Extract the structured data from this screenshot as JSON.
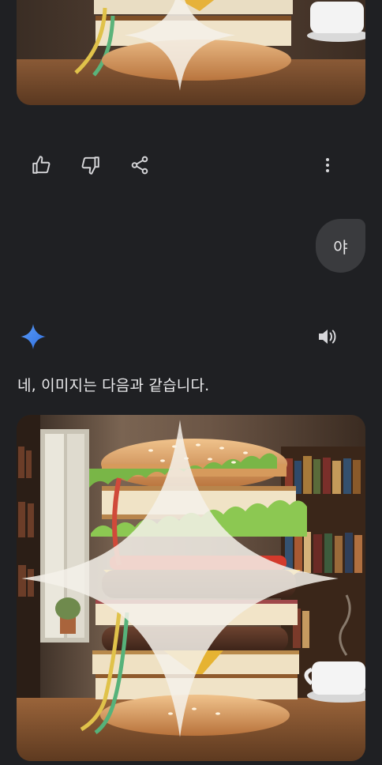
{
  "conversation": {
    "user_message": "야",
    "assistant_response": "네, 이미지는 다음과 같습니다."
  },
  "actions": {
    "icons": [
      "thumbs-up-icon",
      "thumbs-down-icon",
      "share-icon",
      "more-vert-icon"
    ]
  },
  "images": {
    "generated_image_alt": "Burger stacked with books, lettuce, tomato, cheese and patties",
    "badge_icon": "sparkle-icon"
  },
  "colors": {
    "background": "#1f2023",
    "bubble": "#3a3b3e",
    "gemini_blue": "#4f8df7"
  }
}
